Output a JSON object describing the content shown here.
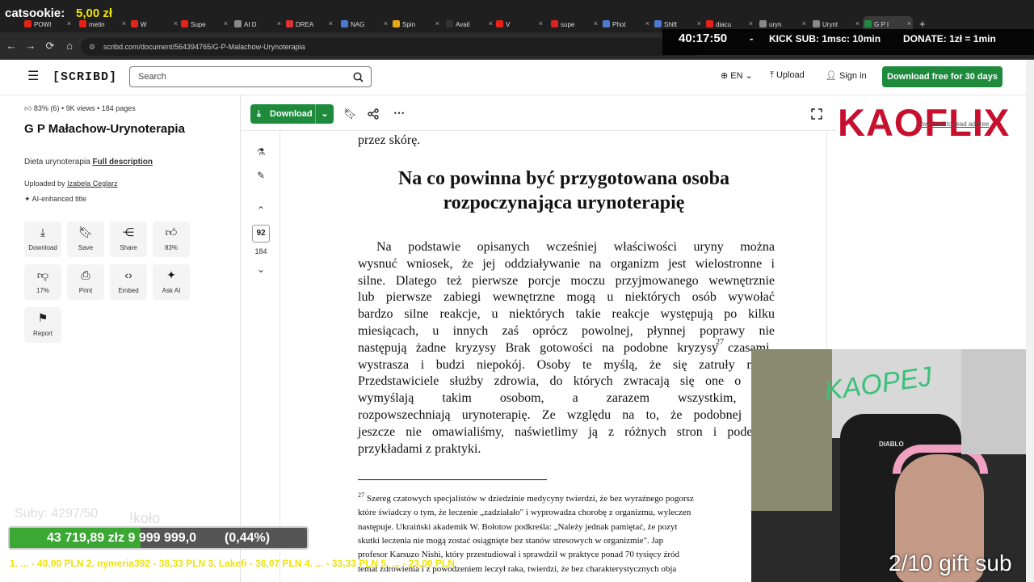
{
  "stream": {
    "donation_label": "catsookie:",
    "donation_amount": "5,00 zł",
    "timer": "40:17:50",
    "dash": "-",
    "kick_sub": "KICK SUB: 1msc: 10min",
    "donate": "DONATE: 1zł = 1min",
    "subs": "Suby: 4297/50",
    "kolo": "!koło",
    "progress_text": "43 719,89 złz  9 999 999,0",
    "progress_pct": "(0,44%)",
    "progress_fraction": 0.44,
    "ticker": "1. ... - 40,00 PLN   2. nymeria392 - 38,33 PLN   3. Lakefi - 36,07 PLN   4. ... - 33,33 PLN   5. ... - 23,00 PLN",
    "gift_sub": "2/10 gift sub",
    "cam_brand": "KAOPEJ",
    "chair_brand": "DIABLO"
  },
  "browser": {
    "tabs": [
      {
        "label": "POWI",
        "color": "#e62117"
      },
      {
        "label": "metin",
        "color": "#e62117"
      },
      {
        "label": "W",
        "color": "#e62117"
      },
      {
        "label": "Supe",
        "color": "#e62117"
      },
      {
        "label": "AI D",
        "color": "#888888"
      },
      {
        "label": "DREA",
        "color": "#d33"
      },
      {
        "label": "NAG",
        "color": "#4a7bd0"
      },
      {
        "label": "Spin",
        "color": "#e6a817"
      },
      {
        "label": "Avail",
        "color": "#333333"
      },
      {
        "label": "V",
        "color": "#e62117"
      },
      {
        "label": "supe",
        "color": "#d22"
      },
      {
        "label": "Phot",
        "color": "#4a7bd0"
      },
      {
        "label": "Shift",
        "color": "#4a7bd0"
      },
      {
        "label": "diacu",
        "color": "#e62117"
      },
      {
        "label": "uryn",
        "color": "#888888"
      },
      {
        "label": "Urynt",
        "color": "#888888"
      },
      {
        "label": "G P I",
        "color": "#1e8a3c"
      }
    ],
    "new_tab": "+",
    "url": "scribd.com/document/564394765/G-P-Malachow-Urynoterapia"
  },
  "header": {
    "logo": "[SCRIBD]",
    "search_placeholder": "Search",
    "lang": "EN",
    "upload": "Upload",
    "signin": "Sign in",
    "download_cta": "Download free for 30 days"
  },
  "doc": {
    "rating": "83% (6)",
    "views": "9K views",
    "pages": "184 pages",
    "title": "G P Małachow-Urynoterapia",
    "desc": "Dieta urynoterapia",
    "full_desc": "Full description",
    "uploaded_by_label": "Uploaded by",
    "uploader": "Izabela Ceglarz",
    "ai_title": "AI-enhanced title",
    "actions": [
      {
        "label": "Download",
        "icon": "download-icon"
      },
      {
        "label": "Save",
        "icon": "bookmark-icon"
      },
      {
        "label": "Share",
        "icon": "share-icon"
      },
      {
        "label": "83%",
        "icon": "thumbs-up-icon"
      },
      {
        "label": "17%",
        "icon": "thumbs-down-icon"
      },
      {
        "label": "Print",
        "icon": "print-icon"
      },
      {
        "label": "Embed",
        "icon": "embed-icon"
      },
      {
        "label": "Ask AI",
        "icon": "sparkle-icon"
      },
      {
        "label": "Report",
        "icon": "flag-icon"
      }
    ]
  },
  "toolbar": {
    "download": "Download",
    "current_page": "92",
    "total_pages": "184"
  },
  "page": {
    "top_line": "przez skórę.",
    "heading_1": "Na co powinna być przygotowana osoba",
    "heading_2": "rozpoczynająca urynoterapię",
    "lines": [
      "Na podstawie opisanych wcześniej właściwości uryny można",
      "wysnuć wniosek, że jej oddziaływanie na organizm jest wielostronne i",
      "silne. Dlatego też pierwsze porcje moczu przyjmowanego wewnętrznie",
      "lub pierwsze zabiegi wewnętrzne mogą u niektórych osób wywołać",
      "bardzo silne reakcje, u niektórych takie reakcje występują po kilku",
      "miesiącach, u innych zaś oprócz powolnej, płynnej poprawy nie",
      "następują żadne kryzysy Brak gotowości na podobne kryzysy",
      "wystrasza i budzi niepokój. Osoby te myślą, że się zatruły mocz",
      "Przedstawiciele służby zdrowia, do których zwracają się one o pom",
      "wymyślają takim osobom, a zarazem wszystkim, kt",
      "rozpowszechniają urynoterapię. Ze względu na to, że podobnej kwe",
      "jeszcze nie omawialiśmy, naświetlimy ją z różnych stron i podeprze",
      "przykładami z praktyki."
    ],
    "footnote_mark": "27",
    "line7_tail": "czasami",
    "footnotes": [
      "Szereg czatowych specjalistów w dziedzinie medycyny twierdzi, że bez wyraźnego pogorsz",
      "które świadczy o tym, że leczenie „zadziałało\" i wyprowadza chorobę z organizmu, wyleczen",
      "następuje. Ukraiński akademik W. Bołotow podkreśla: „Należy jednak pamiętać, że pozyt",
      "skutki leczenia nie mogą zostać osiągnięte bez stanów stresowych w organizmie\". Jap",
      "profesor Karsuzo Nishi, który przestudiował i sprawdził w praktyce ponad 70 tysięcy źród",
      "temat zdrowienia i z powodzeniem leczył raka, twierdzi, że bez charakterystycznych obja"
    ]
  },
  "ad": {
    "brand": "KAOFLIX",
    "ad_free": "Download to read ad-free"
  },
  "colors": {
    "brand_green": "#1e8a3c",
    "ad_red": "#c8102e",
    "donation_yellow": "#f0e400"
  }
}
